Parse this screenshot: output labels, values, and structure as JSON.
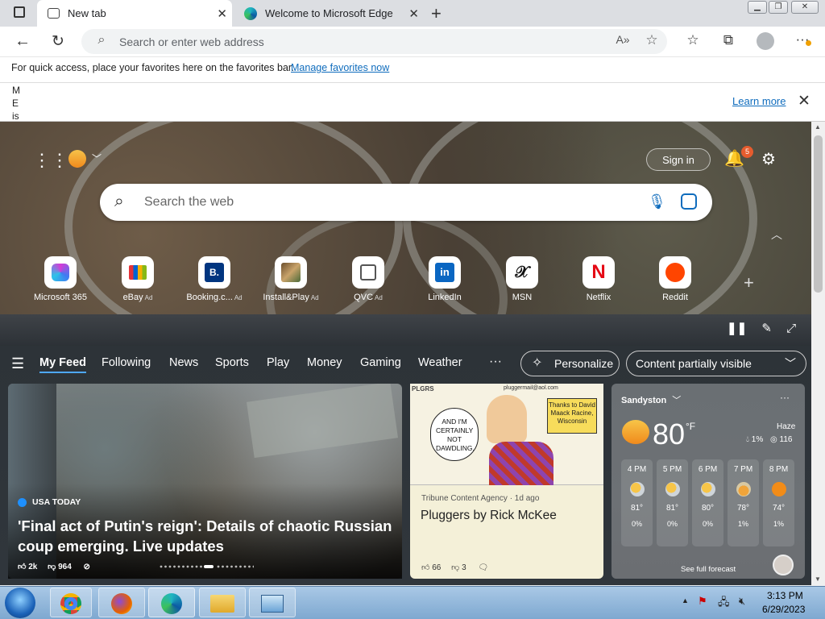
{
  "browser": {
    "tabs": [
      {
        "label": "New tab"
      },
      {
        "label": "Welcome to Microsoft Edge"
      }
    ],
    "address_placeholder": "Search or enter web address",
    "favorites_bar_text": "For quick access, place your favorites here on the favorites bar.",
    "favorites_bar_link": "Manage favorites now",
    "info_bar_text": "M E is",
    "info_bar_link": "Learn more"
  },
  "hero": {
    "sign_in": "Sign in",
    "notification_count": "5",
    "search_placeholder": "Search the web",
    "quick_links": [
      {
        "label": "Microsoft 365",
        "ad": ""
      },
      {
        "label": "eBay",
        "ad": "Ad"
      },
      {
        "label": "Booking.c...",
        "ad": "Ad"
      },
      {
        "label": "Install&Play",
        "ad": "Ad"
      },
      {
        "label": "QVC",
        "ad": "Ad"
      },
      {
        "label": "LinkedIn",
        "ad": ""
      },
      {
        "label": "MSN",
        "ad": ""
      },
      {
        "label": "Netflix",
        "ad": ""
      },
      {
        "label": "Reddit",
        "ad": ""
      }
    ]
  },
  "feed_nav": {
    "items": [
      "My Feed",
      "Following",
      "News",
      "Sports",
      "Play",
      "Money",
      "Gaming",
      "Weather"
    ],
    "more": "···",
    "personalize": "Personalize",
    "content_visibility": "Content partially visible"
  },
  "cards": {
    "news": {
      "source": "USA TODAY",
      "title": "'Final act of Putin's reign': Details of chaotic Russian coup emerging. Live updates",
      "likes": "2k",
      "dislikes": "964"
    },
    "comic": {
      "source": "Tribune Content Agency · 1d ago",
      "title": "Pluggers by Rick McKee",
      "likes": "66",
      "dislikes": "3",
      "bubble": "AND I'M CERTAINLY NOT DAWDLING.",
      "caption": "Thanks to David Maack Racine, Wisconsin",
      "email": "pluggermail@aol.com"
    },
    "weather": {
      "location": "Sandyston",
      "temperature": "80",
      "unit": "°F",
      "condition": "Haze",
      "precip": "1%",
      "aqi": "116",
      "hours": [
        {
          "time": "4 PM",
          "temp": "81°",
          "precip": "0%"
        },
        {
          "time": "5 PM",
          "temp": "81°",
          "precip": "0%"
        },
        {
          "time": "6 PM",
          "temp": "80°",
          "precip": "0%"
        },
        {
          "time": "7 PM",
          "temp": "78°",
          "precip": "1%"
        },
        {
          "time": "8 PM",
          "temp": "74°",
          "precip": "1%"
        }
      ],
      "forecast_link": "See full forecast"
    }
  },
  "taskbar": {
    "time": "3:13 PM",
    "date": "6/29/2023"
  }
}
